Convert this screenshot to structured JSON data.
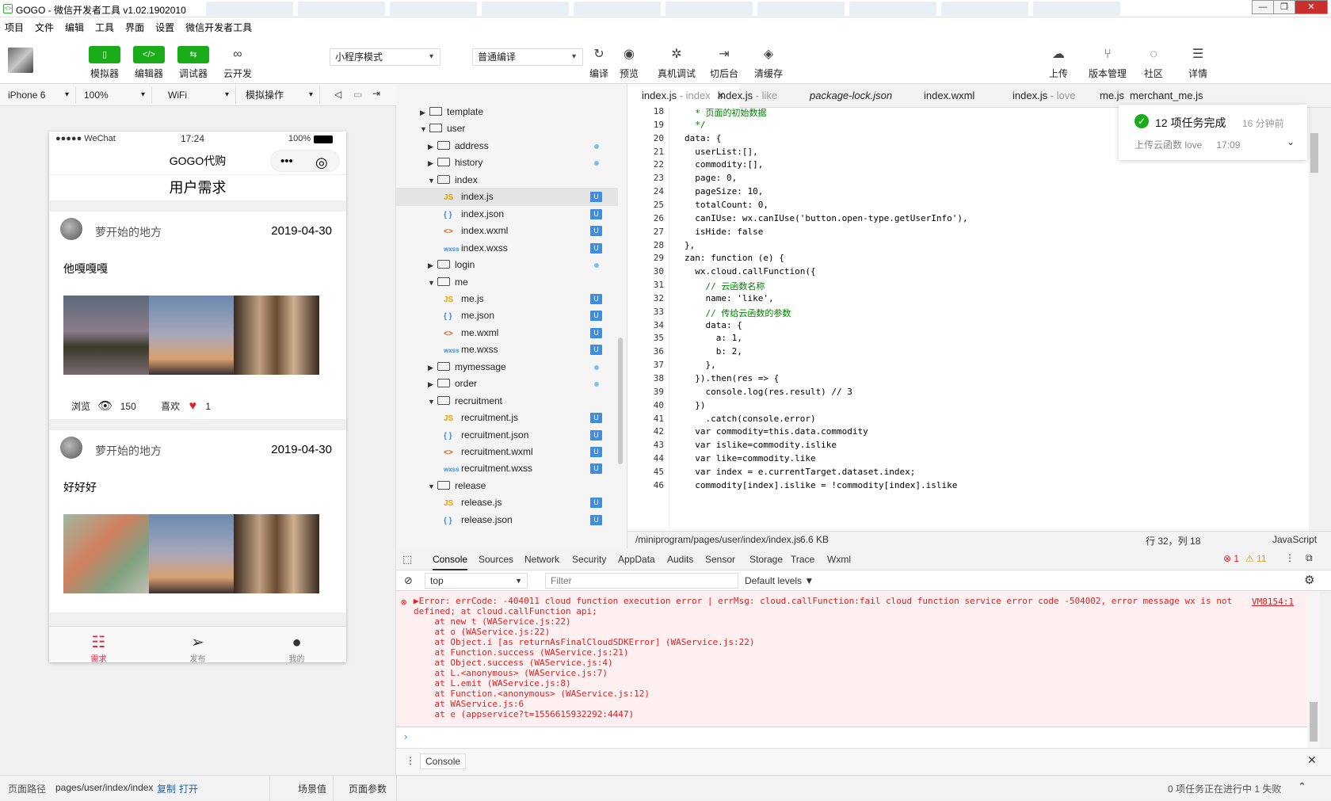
{
  "window": {
    "title": "GOGO - 微信开发者工具 v1.02.1902010"
  },
  "menu": [
    "项目",
    "文件",
    "编辑",
    "工具",
    "界面",
    "设置",
    "微信开发者工具"
  ],
  "toolbar": {
    "green_buttons": [
      {
        "label": "模拟器",
        "glyph": "▯"
      },
      {
        "label": "编辑器",
        "glyph": "</>"
      },
      {
        "label": "调试器",
        "glyph": "⇆"
      }
    ],
    "cloud_label": "云开发",
    "mode_select": "小程序模式",
    "compile_select": "普通编译",
    "right_buttons": [
      {
        "label": "编译",
        "glyph": "↻"
      },
      {
        "label": "预览",
        "glyph": "◉"
      },
      {
        "label": "真机调试",
        "glyph": "✲"
      },
      {
        "label": "切后台",
        "glyph": "⇥"
      },
      {
        "label": "清缓存",
        "glyph": "◈"
      }
    ],
    "far_right": [
      {
        "label": "上传",
        "glyph": "☁"
      },
      {
        "label": "版本管理",
        "glyph": "⑂"
      },
      {
        "label": "社区",
        "glyph": "◌"
      },
      {
        "label": "详情",
        "glyph": "☰"
      }
    ]
  },
  "device_bar": {
    "device": "iPhone 6",
    "zoom": "100%",
    "network": "WiFi",
    "operation": "模拟操作"
  },
  "phone": {
    "status_left": "●●●●● WeChat",
    "status_time": "17:24",
    "status_battery": "100%",
    "nav_title": "GOGO代购",
    "page_header": "用户需求",
    "posts": [
      {
        "user": "萝开始的地方",
        "date": "2019-04-30",
        "text": "他嘎嘎嘎",
        "views_label": "浏览",
        "views": "150",
        "likes_label": "喜欢",
        "likes": "1"
      },
      {
        "user": "萝开始的地方",
        "date": "2019-04-30",
        "text": "好好好"
      }
    ],
    "tabs": [
      {
        "label": "需求",
        "glyph": "☷"
      },
      {
        "label": "发布",
        "glyph": "➢"
      },
      {
        "label": "我的",
        "glyph": "●"
      }
    ]
  },
  "tree": {
    "rows": [
      {
        "label": "template",
        "type": "folder",
        "open": false,
        "depth": 1
      },
      {
        "label": "user",
        "type": "folder",
        "open": true,
        "depth": 1
      },
      {
        "label": "address",
        "type": "folder",
        "open": false,
        "depth": 2,
        "dot": true
      },
      {
        "label": "history",
        "type": "folder",
        "open": false,
        "depth": 2,
        "dot": true
      },
      {
        "label": "index",
        "type": "folder",
        "open": true,
        "depth": 2
      },
      {
        "label": "index.js",
        "type": "js",
        "depth": 3,
        "badge": "U",
        "selected": true
      },
      {
        "label": "index.json",
        "type": "json",
        "depth": 3,
        "badge": "U"
      },
      {
        "label": "index.wxml",
        "type": "wxml",
        "depth": 3,
        "badge": "U"
      },
      {
        "label": "index.wxss",
        "type": "wxss",
        "depth": 3,
        "badge": "U"
      },
      {
        "label": "login",
        "type": "folder",
        "open": false,
        "depth": 2,
        "dot": true
      },
      {
        "label": "me",
        "type": "folder",
        "open": true,
        "depth": 2
      },
      {
        "label": "me.js",
        "type": "js",
        "depth": 3,
        "badge": "U"
      },
      {
        "label": "me.json",
        "type": "json",
        "depth": 3,
        "badge": "U"
      },
      {
        "label": "me.wxml",
        "type": "wxml",
        "depth": 3,
        "badge": "U"
      },
      {
        "label": "me.wxss",
        "type": "wxss",
        "depth": 3,
        "badge": "U"
      },
      {
        "label": "mymessage",
        "type": "folder",
        "open": false,
        "depth": 2,
        "dot": true
      },
      {
        "label": "order",
        "type": "folder",
        "open": false,
        "depth": 2,
        "dot": true
      },
      {
        "label": "recruitment",
        "type": "folder",
        "open": true,
        "depth": 2
      },
      {
        "label": "recruitment.js",
        "type": "js",
        "depth": 3,
        "badge": "U"
      },
      {
        "label": "recruitment.json",
        "type": "json",
        "depth": 3,
        "badge": "U"
      },
      {
        "label": "recruitment.wxml",
        "type": "wxml",
        "depth": 3,
        "badge": "U"
      },
      {
        "label": "recruitment.wxss",
        "type": "wxss",
        "depth": 3,
        "badge": "U"
      },
      {
        "label": "release",
        "type": "folder",
        "open": true,
        "depth": 2
      },
      {
        "label": "release.js",
        "type": "js",
        "depth": 3,
        "badge": "U"
      },
      {
        "label": "release.json",
        "type": "json",
        "depth": 3,
        "badge": "U"
      }
    ]
  },
  "editor_tabs": [
    {
      "name": "index.js",
      "hint": "- index",
      "active": true
    },
    {
      "name": "index.js",
      "hint": "- like"
    },
    {
      "name": "package-lock.json",
      "hint": ""
    },
    {
      "name": "index.wxml",
      "hint": ""
    },
    {
      "name": "index.js",
      "hint": "- love"
    },
    {
      "name": "me.js",
      "hint": ""
    },
    {
      "name": "merchant_me.js",
      "hint": ""
    }
  ],
  "code": [
    {
      "n": "18",
      "t": "  * 页面的初始数据",
      "c": "cm"
    },
    {
      "n": "19",
      "t": "  */",
      "c": "cm"
    },
    {
      "n": "20",
      "t": "data: {",
      "c": ""
    },
    {
      "n": "21",
      "t": "  userList:[],",
      "c": ""
    },
    {
      "n": "22",
      "t": "  commodity:[],",
      "c": ""
    },
    {
      "n": "23",
      "t": "  page: 0,",
      "c": ""
    },
    {
      "n": "24",
      "t": "  pageSize: 10,",
      "c": ""
    },
    {
      "n": "25",
      "t": "  totalCount: 0,",
      "c": ""
    },
    {
      "n": "26",
      "t": "  canIUse: wx.canIUse('button.open-type.getUserInfo'),",
      "c": ""
    },
    {
      "n": "27",
      "t": "  isHide: false",
      "c": ""
    },
    {
      "n": "28",
      "t": "},",
      "c": ""
    },
    {
      "n": "29",
      "t": "zan: function (e) {",
      "c": ""
    },
    {
      "n": "30",
      "t": "  wx.cloud.callFunction({",
      "c": ""
    },
    {
      "n": "31",
      "t": "    // 云函数名称",
      "c": "cm"
    },
    {
      "n": "32",
      "t": "    name: 'like',",
      "c": ""
    },
    {
      "n": "33",
      "t": "    // 传给云函数的参数",
      "c": "cm"
    },
    {
      "n": "34",
      "t": "    data: {",
      "c": ""
    },
    {
      "n": "35",
      "t": "      a: 1,",
      "c": ""
    },
    {
      "n": "36",
      "t": "      b: 2,",
      "c": ""
    },
    {
      "n": "37",
      "t": "    },",
      "c": ""
    },
    {
      "n": "38",
      "t": "  }).then(res => {",
      "c": ""
    },
    {
      "n": "39",
      "t": "    console.log(res.result) // 3",
      "c": ""
    },
    {
      "n": "40",
      "t": "  })",
      "c": ""
    },
    {
      "n": "41",
      "t": "    .catch(console.error)",
      "c": ""
    },
    {
      "n": "42",
      "t": "  var commodity=this.data.commodity",
      "c": ""
    },
    {
      "n": "43",
      "t": "  var islike=commodity.islike",
      "c": ""
    },
    {
      "n": "44",
      "t": "  var like=commodity.like",
      "c": ""
    },
    {
      "n": "45",
      "t": "  var index = e.currentTarget.dataset.index;",
      "c": ""
    },
    {
      "n": "46",
      "t": "  commodity[index].islike = !commodity[index].islike",
      "c": ""
    }
  ],
  "editor_status": {
    "path": "/miniprogram/pages/user/index/index.js",
    "size": "6.6 KB",
    "cursor": "行 32，列 18",
    "lang": "JavaScript"
  },
  "notification": {
    "title": "12 项任务完成",
    "time": "16 分钟前",
    "detail": "上传云函数 love",
    "detail_time": "17:09"
  },
  "devtools": {
    "tabs": [
      "Console",
      "Sources",
      "Network",
      "Security",
      "AppData",
      "Audits",
      "Sensor",
      "Storage",
      "Trace",
      "Wxml"
    ],
    "errors": "1",
    "warnings": "11",
    "context": "top",
    "filter_placeholder": "Filter",
    "levels": "Default levels",
    "source": "VM8154:1",
    "lines": [
      "▶Error: errCode: -404011 cloud function execution error | errMsg: cloud.callFunction:fail cloud function service error code -504002, error message wx is not",
      "defined; at cloud.callFunction api;",
      "    at new t (WAService.js:22)",
      "    at o (WAService.js:22)",
      "    at Object.i [as returnAsFinalCloudSDKError] (WAService.js:22)",
      "    at Function.success (WAService.js:21)",
      "    at Object.success (WAService.js:4)",
      "    at L.<anonymous> (WAService.js:7)",
      "    at L.emit (WAService.js:8)",
      "    at Function.<anonymous> (WAService.js:12)",
      "    at WAService.js:6",
      "    at e (appservice?t=1556615932292:4447)"
    ],
    "drawer_tab": "Console"
  },
  "statusbar": {
    "path_label": "页面路径",
    "path": "pages/user/index/index",
    "copy": "复制",
    "open": "打开",
    "scene": "场景值",
    "params": "页面参数",
    "right": "0 项任务正在进行中 1 失败"
  },
  "colors": {
    "green": "#1aad19",
    "error": "#e02020",
    "badge": "#3a8ee6"
  }
}
